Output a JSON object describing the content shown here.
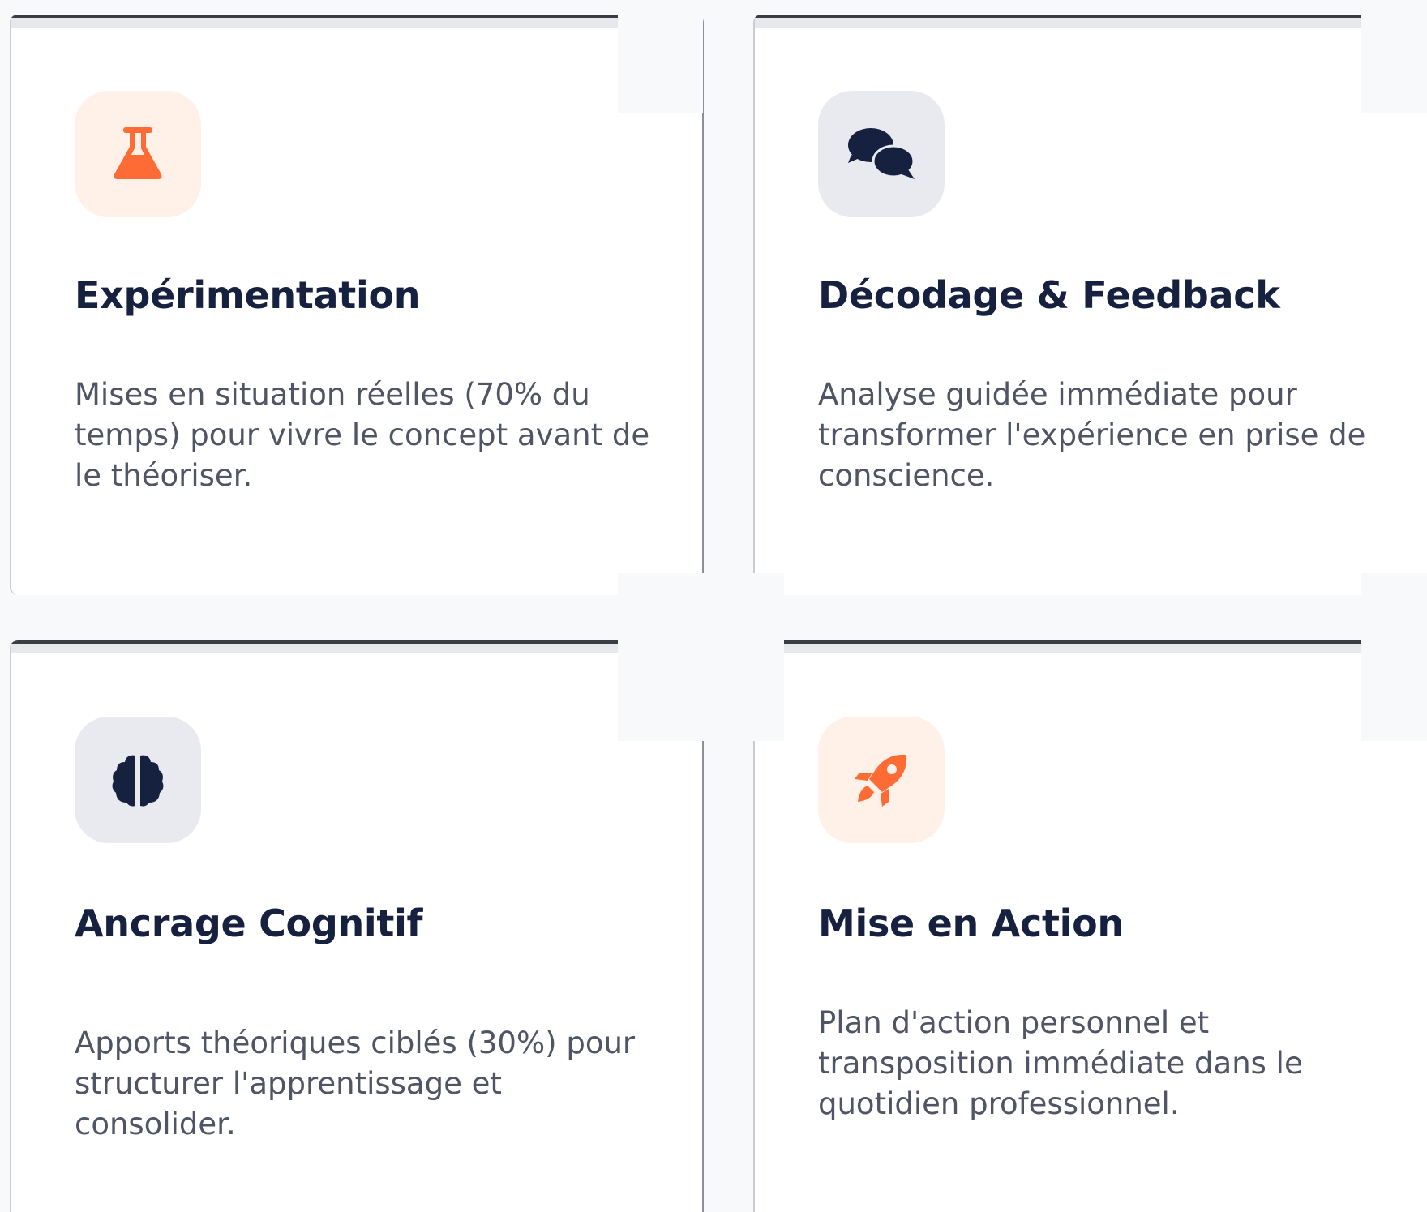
{
  "cards": [
    {
      "title": "Expérimentation",
      "description": "Mises en situation réelles (70% du temps) pour vivre le concept avant de le théoriser.",
      "icon": "flask-icon",
      "icon_color": "#ff6b35",
      "icon_bg": "#fff1e8"
    },
    {
      "title": "Décodage & Feedback",
      "description": "Analyse guidée immédiate pour transformer l'expérience en prise de conscience.",
      "icon": "chat-bubbles-icon",
      "icon_color": "#15213f",
      "icon_bg": "#e9eaf0"
    },
    {
      "title": "Ancrage Cognitif",
      "description": "Apports théoriques ciblés (30%) pour structurer l'apprentissage et consolider.",
      "icon": "brain-icon",
      "icon_color": "#15213f",
      "icon_bg": "#e9eaf0"
    },
    {
      "title": "Mise en Action",
      "description": "Plan d'action personnel et transposition immédiate dans le quotidien professionnel.",
      "icon": "rocket-icon",
      "icon_color": "#ff6b35",
      "icon_bg": "#fff1e8"
    }
  ]
}
